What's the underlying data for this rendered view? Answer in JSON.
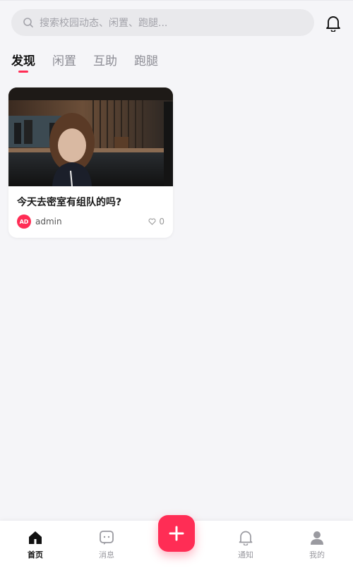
{
  "search": {
    "placeholder": "搜索校园动态、闲置、跑腿..."
  },
  "header": {
    "bell_icon": "bell-icon"
  },
  "tabs": [
    {
      "label": "发现",
      "active": true
    },
    {
      "label": "闲置",
      "active": false
    },
    {
      "label": "互助",
      "active": false
    },
    {
      "label": "跑腿",
      "active": false
    }
  ],
  "feed": {
    "posts": [
      {
        "image": "photo of a girl with long brown hair sitting in a dimly lit cafe",
        "title": "今天去密室有组队的吗?",
        "author": {
          "name": "admin",
          "avatar_text": "AD"
        },
        "likes": "0"
      }
    ]
  },
  "fab": {
    "icon": "plus-icon"
  },
  "bottom_nav": {
    "items": [
      {
        "label": "首页",
        "icon": "home-icon",
        "active": true
      },
      {
        "label": "消息",
        "icon": "message-icon",
        "active": false
      },
      {
        "label": "通知",
        "icon": "bell-icon",
        "active": false
      },
      {
        "label": "我的",
        "icon": "user-icon",
        "active": false
      }
    ]
  },
  "colors": {
    "accent": "#ff2d55",
    "background": "#f5f5f8",
    "text": "#1a1a1a",
    "muted": "#9a9aa0"
  }
}
